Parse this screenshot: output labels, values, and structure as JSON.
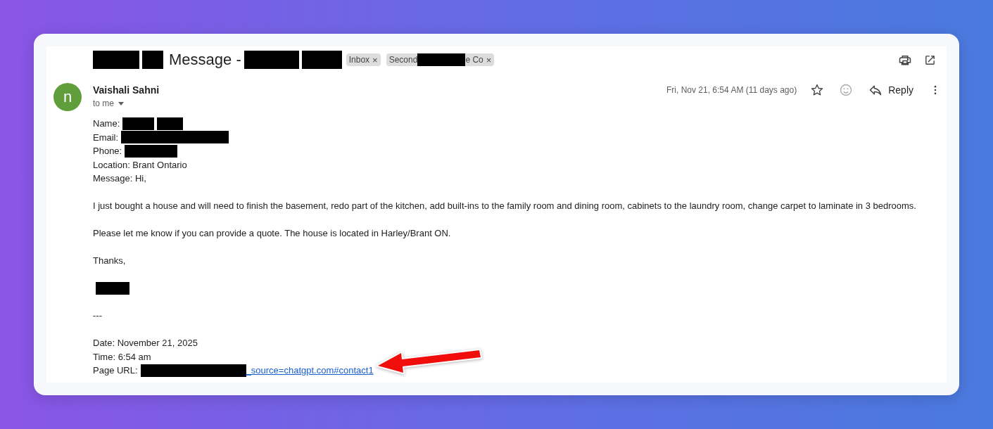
{
  "subject": {
    "segments": [
      {
        "kind": "redaction"
      },
      {
        "kind": "redaction"
      },
      {
        "kind": "text",
        "text": "Message -"
      },
      {
        "kind": "redaction"
      },
      {
        "kind": "redaction"
      }
    ]
  },
  "labels": [
    {
      "segments": [
        {
          "kind": "text",
          "text": "Inbox"
        }
      ],
      "close": "×"
    },
    {
      "segments": [
        {
          "kind": "text",
          "text": "Second"
        },
        {
          "kind": "redaction"
        },
        {
          "kind": "text",
          "text": "e Co"
        }
      ],
      "close": "×"
    }
  ],
  "sender": {
    "avatar": "n",
    "name": "Vaishali Sahni",
    "recipient": "to me",
    "date": "Fri, Nov 21, 6:54 AM (11 days ago)",
    "starred": false,
    "reply": "Reply"
  },
  "body": [
    [
      [
        {
          "kind": "text",
          "text": "Name:"
        },
        {
          "kind": "redaction"
        },
        {
          "kind": "redaction"
        }
      ],
      [
        {
          "kind": "text",
          "text": "Email:"
        },
        {
          "kind": "redaction"
        }
      ],
      [
        {
          "kind": "text",
          "text": "Phone:"
        },
        {
          "kind": "redaction"
        }
      ],
      [
        {
          "kind": "text",
          "text": "Location: Brant Ontario"
        }
      ],
      [
        {
          "kind": "text",
          "text": "Message: Hi,"
        }
      ]
    ],
    [
      [
        {
          "kind": "text",
          "text": "I just bought a house and will need to finish the basement, redo part of the kitchen, add built-ins to the family room and dining room, cabinets to the laundry room, change carpet to laminate in 3 bedrooms."
        }
      ]
    ],
    [
      [
        {
          "kind": "text",
          "text": "Please let me know if you can provide a quote. The house is located in Harley/Brant ON."
        }
      ]
    ],
    [
      [
        {
          "kind": "text",
          "text": "Thanks,"
        }
      ]
    ],
    [
      [
        {
          "kind": "redaction"
        }
      ]
    ],
    [
      [
        {
          "kind": "text",
          "text": "---"
        }
      ]
    ],
    [
      [
        {
          "kind": "text",
          "text": "Date: November 21, 2025"
        }
      ],
      [
        {
          "kind": "text",
          "text": "Time: 6:54 am"
        }
      ],
      [
        {
          "kind": "text",
          "text": "Page URL:"
        },
        {
          "kind": "redaction"
        },
        {
          "kind": "link",
          "text": "_source=chatgpt.com#contact1"
        }
      ]
    ]
  ],
  "annotation": {
    "kind": "arrow"
  }
}
